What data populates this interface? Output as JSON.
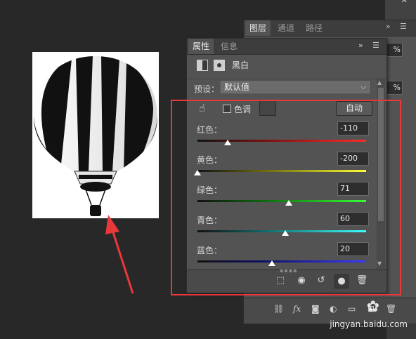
{
  "colors": {
    "annotation": "#e8383a",
    "panel": "#535353",
    "background": "#282828"
  },
  "layers_panel": {
    "tabs": [
      "图层",
      "通道",
      "路径"
    ],
    "opacity_suffix": "%",
    "fill_suffix": "%",
    "footer_icons": [
      "link-icon",
      "fx-icon",
      "mask-icon",
      "adjustment-icon",
      "folder-icon",
      "new-layer-icon",
      "trash-icon"
    ],
    "fx_label": "fx"
  },
  "properties_panel": {
    "tabs": [
      "属性",
      "信息"
    ],
    "title": "黑白",
    "preset_label": "预设：",
    "preset_value": "默认值",
    "tint_label": "色调",
    "auto_button": "自动",
    "sliders": [
      {
        "label": "红色：",
        "value": "-110",
        "min": -200,
        "max": 300
      },
      {
        "label": "黄色：",
        "value": "-200",
        "min": -200,
        "max": 300
      },
      {
        "label": "绿色：",
        "value": "71",
        "min": -200,
        "max": 300
      },
      {
        "label": "青色：",
        "value": "60",
        "min": -200,
        "max": 300
      },
      {
        "label": "蓝色：",
        "value": "20",
        "min": -200,
        "max": 300
      }
    ],
    "footer_icons": [
      "clip-to-layer-icon",
      "view-previous-state-icon",
      "reset-icon",
      "visibility-eye-icon",
      "trash-icon"
    ]
  },
  "canvas": {
    "subject": "hot-air-balloon-icon"
  },
  "watermark": {
    "text": "jingyan.baidu.com"
  }
}
